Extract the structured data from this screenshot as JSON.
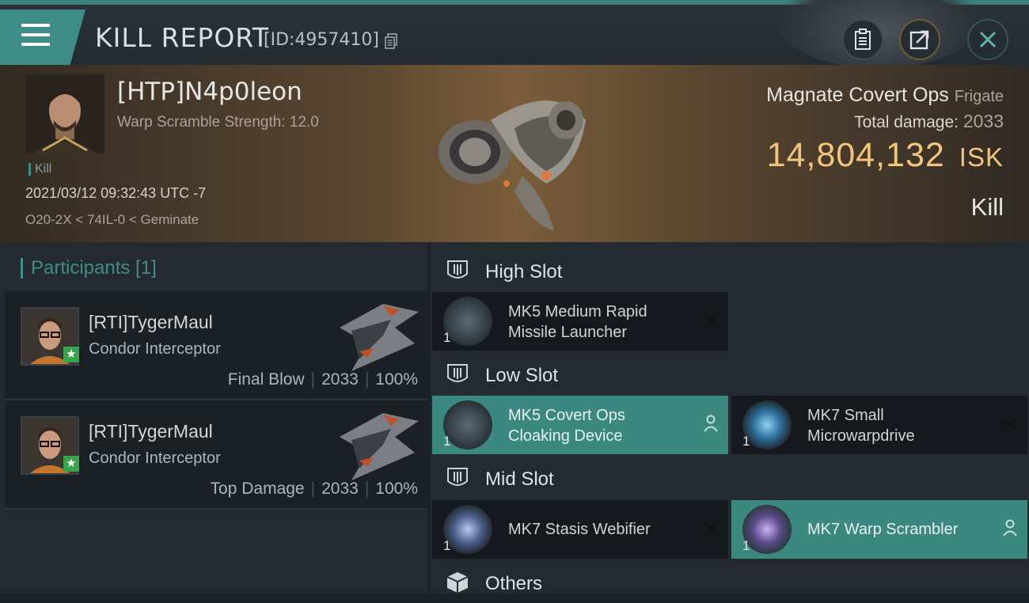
{
  "header": {
    "title": "KILL REPORT",
    "report_id": "[ID:4957410]"
  },
  "victim": {
    "name": "[HTP]N4p0leon",
    "warp_scramble": "Warp Scramble Strength: 12.0",
    "tag": "Kill",
    "time": "2021/03/12 09:32:43 UTC -7",
    "location": "O20-2X < 74IL-0 < Geminate",
    "ship": "Magnate Covert Ops",
    "ship_class": "Frigate",
    "total_damage_label": "Total damage:",
    "total_damage": "2033",
    "isk_value": "14,804,132",
    "isk_currency": "ISK",
    "result": "Kill"
  },
  "participants": {
    "label": "Participants [1]",
    "rows": [
      {
        "name": "[RTI]TygerMaul",
        "ship": "Condor Interceptor",
        "role": "Final Blow",
        "damage": "2033",
        "percent": "100%"
      },
      {
        "name": "[RTI]TygerMaul",
        "ship": "Condor Interceptor",
        "role": "Top Damage",
        "damage": "2033",
        "percent": "100%"
      }
    ]
  },
  "slots": {
    "high": {
      "label": "High Slot",
      "modules": [
        {
          "name_line1": "MK5 Medium Rapid",
          "name_line2": "Missile Launcher",
          "qty": "1",
          "state": "destroyed"
        }
      ]
    },
    "low": {
      "label": "Low Slot",
      "modules": [
        {
          "name_line1": "MK5 Covert Ops",
          "name_line2": "Cloaking Device",
          "qty": "1",
          "state": "dropped"
        },
        {
          "name_line1": "MK7 Small",
          "name_line2": "Microwarpdrive",
          "qty": "1",
          "state": "destroyed"
        }
      ]
    },
    "mid": {
      "label": "Mid Slot",
      "modules": [
        {
          "name_line1": "MK7 Stasis Webifier",
          "name_line2": "",
          "qty": "1",
          "state": "destroyed"
        },
        {
          "name_line1": "MK7 Warp Scrambler",
          "name_line2": "",
          "qty": "1",
          "state": "dropped"
        }
      ]
    },
    "others": {
      "label": "Others"
    }
  },
  "colors": {
    "accent_teal": "#3d8d86",
    "isk_gold": "#f1c57b",
    "fitted_module": "#3a8880"
  }
}
